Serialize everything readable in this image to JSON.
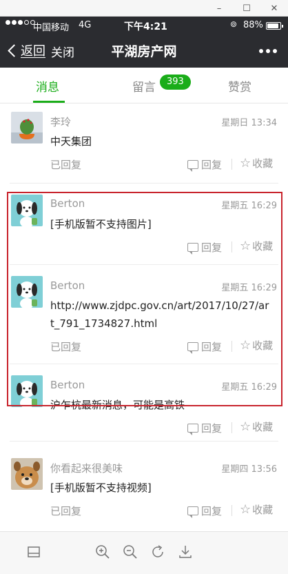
{
  "window": {
    "minimize_symbol": "–",
    "maximize_symbol": "☐",
    "close_symbol": "✕"
  },
  "statusbar": {
    "carrier": "中国移动",
    "network": "4G",
    "time": "下午4:21",
    "battery": "88%",
    "battery_level": 0.88
  },
  "navbar": {
    "back": "返回",
    "close": "关闭",
    "title": "平湖房产网"
  },
  "tabs": {
    "messages": "消息",
    "comments": "留言",
    "comments_badge": "393",
    "tips": "赞赏"
  },
  "messages": [
    {
      "author": "李玲",
      "date": "星期日 13:34",
      "content": "中天集团",
      "replied": "已回复",
      "reply": "回复",
      "favorite": "收藏",
      "avatar": "cactus-photo"
    },
    {
      "author": "Berton",
      "date": "星期五 16:29",
      "content": "[手机版暂不支持图片]",
      "replied": "",
      "reply": "回复",
      "favorite": "收藏",
      "avatar": "cartoon-dog"
    },
    {
      "author": "Berton",
      "date": "星期五 16:29",
      "content": "http://www.zjdpc.gov.cn/art/2017/10/27/art_791_1734827.html",
      "replied": "已回复",
      "reply": "回复",
      "favorite": "收藏",
      "avatar": "cartoon-dog"
    },
    {
      "author": "Berton",
      "date": "星期五 16:29",
      "content": "沪乍杭最新消息，可能是高铁",
      "replied": "",
      "reply": "回复",
      "favorite": "收藏",
      "avatar": "cartoon-dog"
    },
    {
      "author": "你看起来很美味",
      "date": "星期四 13:56",
      "content": "[手机版暂不支持视频]",
      "replied": "已回复",
      "reply": "回复",
      "favorite": "收藏",
      "avatar": "dog-photo"
    }
  ],
  "colors": {
    "accent_green": "#1aad19",
    "navbar_bg": "#2b2c30",
    "highlight_red": "#c8232c"
  }
}
